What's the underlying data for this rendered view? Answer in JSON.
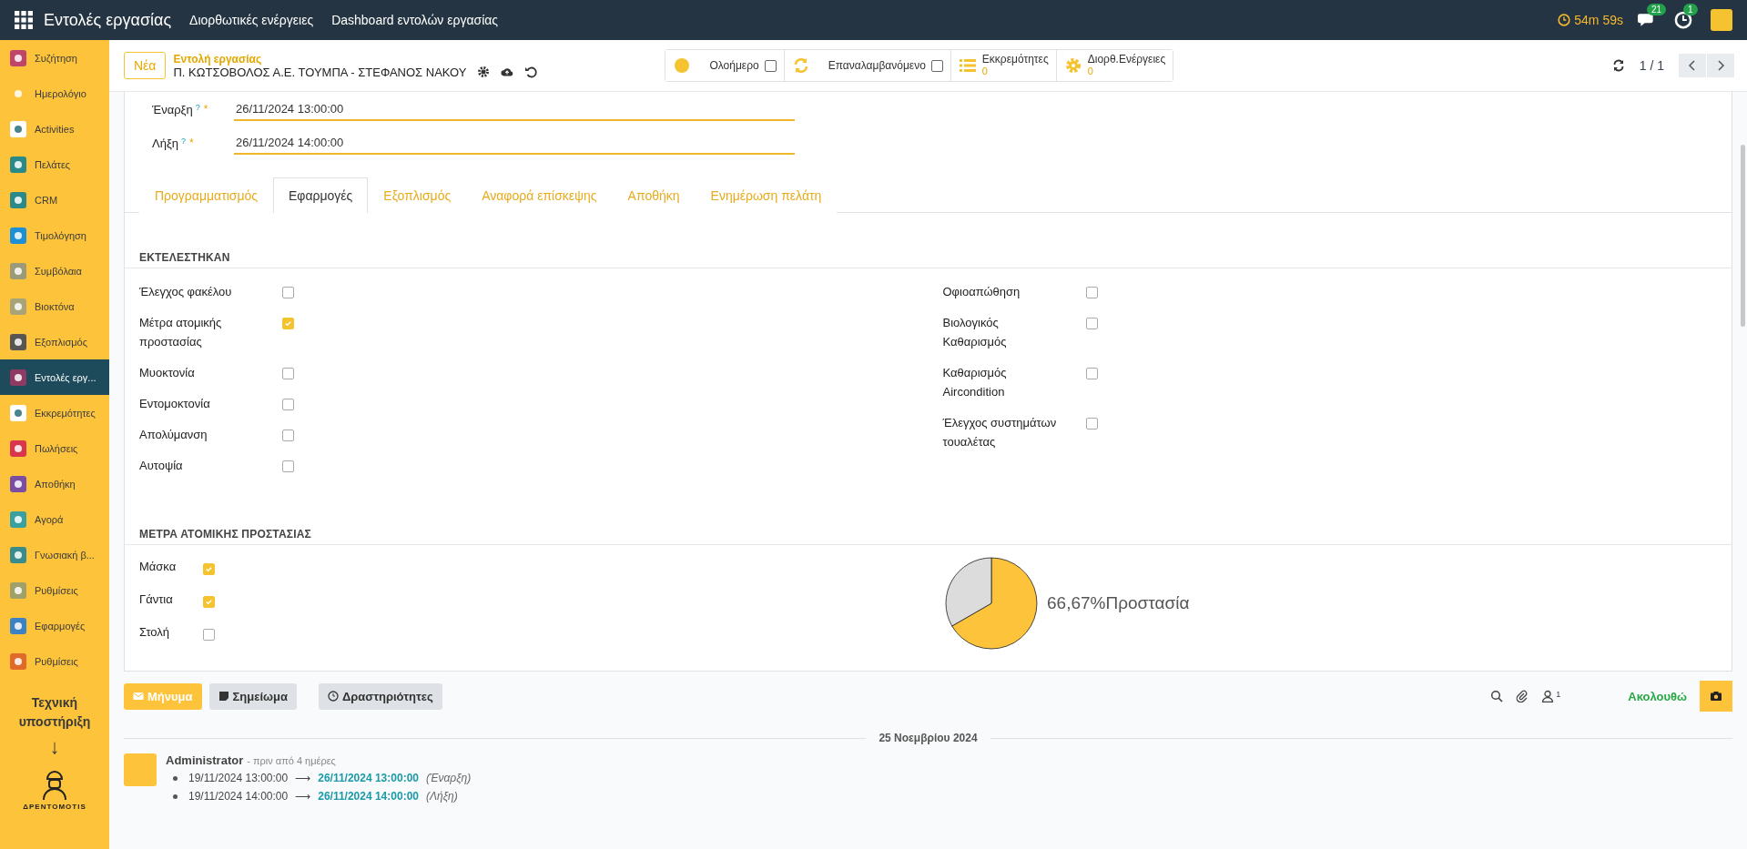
{
  "topbar": {
    "app_title": "Εντολές εργασίας",
    "menu": [
      "Διορθωτικές ενέργειες",
      "Dashboard εντολών εργασίας"
    ],
    "timer": "54m 59s",
    "messages_badge": "21",
    "activities_badge": "1"
  },
  "sidebar": {
    "items": [
      {
        "label": "Συζήτηση",
        "selected": false
      },
      {
        "label": "Ημερολόγιο",
        "selected": false
      },
      {
        "label": "Activities",
        "selected": false
      },
      {
        "label": "Πελάτες",
        "selected": false
      },
      {
        "label": "CRM",
        "selected": false
      },
      {
        "label": "Τιμολόγηση",
        "selected": false
      },
      {
        "label": "Συμβόλαια",
        "selected": false
      },
      {
        "label": "Βιοκτόνα",
        "selected": false
      },
      {
        "label": "Εξοπλισμός",
        "selected": false
      },
      {
        "label": "Εντολές εργ...",
        "selected": true
      },
      {
        "label": "Εκκρεμότητες",
        "selected": false
      },
      {
        "label": "Πωλήσεις",
        "selected": false
      },
      {
        "label": "Αποθήκη",
        "selected": false
      },
      {
        "label": "Αγορά",
        "selected": false
      },
      {
        "label": "Γνωσιακή β...",
        "selected": false
      },
      {
        "label": "Ρυθμίσεις",
        "selected": false
      },
      {
        "label": "Εφαρμογές",
        "selected": false
      },
      {
        "label": "Ρυθμίσεις",
        "selected": false
      }
    ],
    "support_label": "Τεχνική υποστήριξη",
    "support_arrow": "↓",
    "logo_text": "ΔΡΕΝΤΟΜΟTIS"
  },
  "control_panel": {
    "new_button": "Νέα",
    "breadcrumb": "Εντολή εργασίας",
    "record_name": "Π. ΚΩΤΣΟΒΟΛΟΣ Α.Ε. ΤΟΥΜΠΑ - ΣΤΕΦΑΝΟΣ ΝΑΚΟΥ",
    "stat_buttons": [
      {
        "kind": "toggle",
        "label": "Ολοήμερο",
        "checked": false
      },
      {
        "kind": "toggle",
        "label": "Επαναλαμβανόμενο",
        "checked": false
      },
      {
        "kind": "counter",
        "label": "Εκκρεμότητες",
        "value": "0"
      },
      {
        "kind": "counter",
        "label": "Διορθ.Ενέργειες",
        "value": "0"
      }
    ],
    "pager": "1 / 1"
  },
  "form": {
    "fields": [
      {
        "label": "Έναρξη",
        "help_mark": "?",
        "required_mark": "*",
        "value": "26/11/2024 13:00:00"
      },
      {
        "label": "Λήξη",
        "help_mark": "?",
        "required_mark": "*",
        "value": "26/11/2024 14:00:00"
      }
    ],
    "tabs": [
      {
        "label": "Προγραμματισμός",
        "selected": false
      },
      {
        "label": "Εφαρμογές",
        "selected": true
      },
      {
        "label": "Εξοπλισμός",
        "selected": false
      },
      {
        "label": "Αναφορά επίσκεψης",
        "selected": false
      },
      {
        "label": "Αποθήκη",
        "selected": false
      },
      {
        "label": "Ενημέρωση πελάτη",
        "selected": false
      }
    ],
    "executed": {
      "title": "ΕΚΤΕΛΕΣΤΗΚΑΝ",
      "left": [
        {
          "label": "Έλεγχος φακέλου",
          "checked": false
        },
        {
          "label": "Μέτρα ατομικής προστασίας",
          "checked": true
        },
        {
          "label": "Μυοκτονία",
          "checked": false
        },
        {
          "label": "Εντομοκτονία",
          "checked": false
        },
        {
          "label": "Απολύμανση",
          "checked": false
        },
        {
          "label": "Αυτοψία",
          "checked": false
        }
      ],
      "right": [
        {
          "label": "Οφιοαπώθηση",
          "checked": false
        },
        {
          "label": "Βιολογικός Καθαρισμός",
          "checked": false
        },
        {
          "label": "Καθαρισμός Aircondition",
          "checked": false
        },
        {
          "label": "Έλεγχος συστημάτων τουαλέτας",
          "checked": false
        }
      ]
    },
    "protection": {
      "title": "ΜΕΤΡΑ ΑΤΟΜΙΚΗΣ ΠΡΟΣΤΑΣΙΑΣ",
      "items": [
        {
          "label": "Μάσκα",
          "checked": true
        },
        {
          "label": "Γάντια",
          "checked": true
        },
        {
          "label": "Στολή",
          "checked": false
        }
      ],
      "gauge": {
        "chart_data": {
          "type": "pie",
          "values": [
            66.67,
            33.33
          ]
        },
        "label": "66,67%Προστασία"
      }
    }
  },
  "chatter": {
    "buttons": [
      {
        "kind": "primary",
        "label": "Μήνυμα"
      },
      {
        "kind": "note",
        "label": "Σημείωμα"
      },
      {
        "kind": "activity",
        "label": "Δραστηριότητες"
      }
    ],
    "followers_count": "1",
    "follow_label": "Ακολουθώ",
    "date": "25 Νοεμβρίου 2024",
    "messages": [
      {
        "author": "Administrator",
        "time": "- πριν από 4 ημέρες",
        "changes": [
          {
            "old": "19/11/2024 13:00:00",
            "arrow": "⟶",
            "new": "26/11/2024 13:00:00",
            "field": "(Έναρξη)"
          },
          {
            "old": "19/11/2024 14:00:00",
            "arrow": "⟶",
            "new": "26/11/2024 14:00:00",
            "field": "(Λήξη)"
          }
        ]
      }
    ]
  }
}
